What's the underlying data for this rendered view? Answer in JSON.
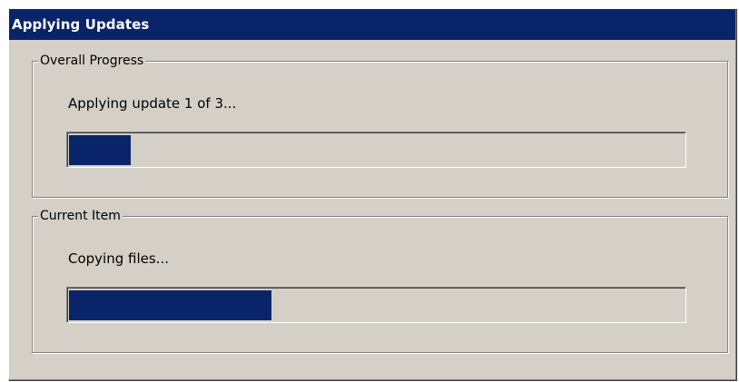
{
  "window": {
    "title": "Applying Updates"
  },
  "overall": {
    "legend": "Overall Progress",
    "status": "Applying update 1 of 3...",
    "progress_fraction": 0.1
  },
  "current": {
    "legend": "Current Item",
    "status": "Copying files...",
    "progress_fraction": 0.33
  },
  "colors": {
    "title_bar": "#0a246a",
    "progress_fill": "#0a246a",
    "dialog_face": "#d4d0c8"
  }
}
